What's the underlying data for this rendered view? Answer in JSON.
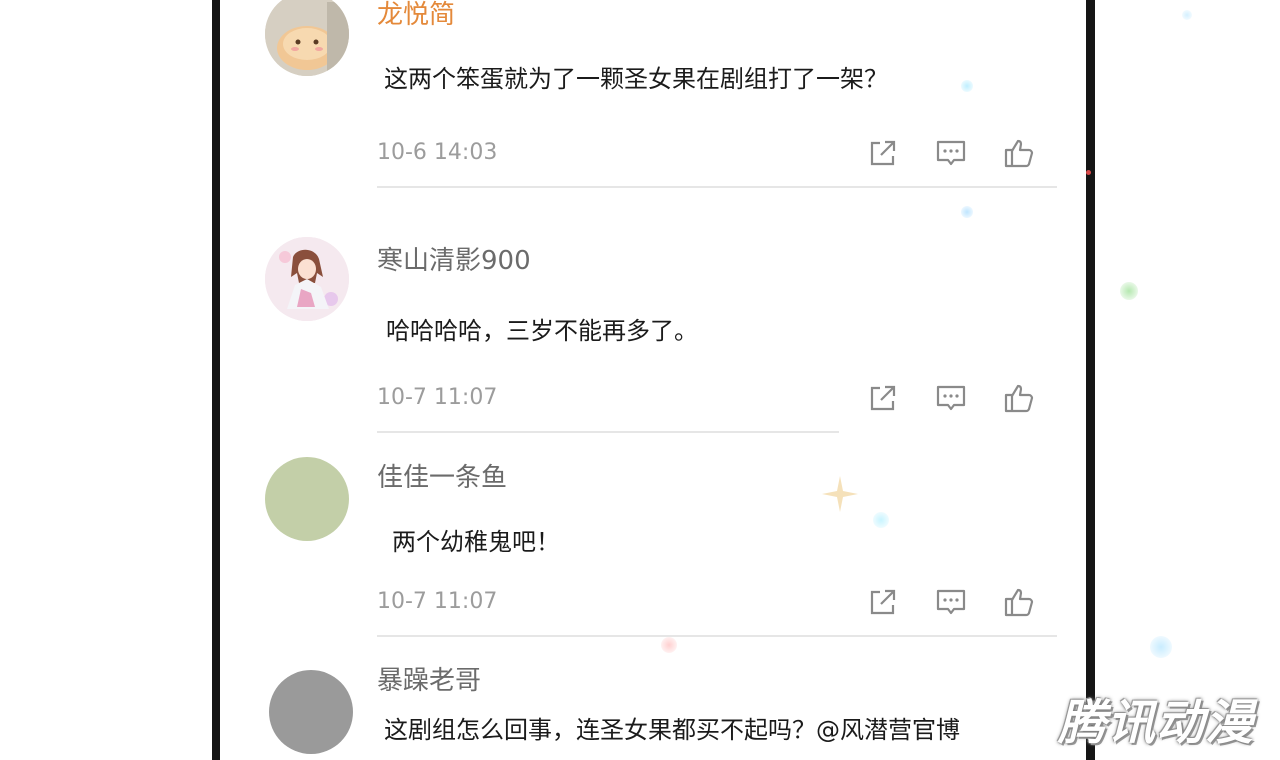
{
  "comments": [
    {
      "username": "龙悦简",
      "text": "这两个笨蛋就为了一颗圣女果在剧组打了一架？",
      "time": "10-6 14:03",
      "avatar": "bunny-plush-avatar",
      "username_color": "#e4893a"
    },
    {
      "username": "寒山清影900",
      "text": "哈哈哈哈，三岁不能再多了。",
      "time": "10-7 11:07",
      "avatar": "anime-girl-avatar"
    },
    {
      "username": "佳佳一条鱼",
      "text": "两个幼稚鬼吧！",
      "time": "10-7 11:07",
      "avatar": "green-circle-avatar"
    },
    {
      "username": "暴躁老哥",
      "text": "这剧组怎么回事，连圣女果都买不起吗？@风潜营官博",
      "avatar": "gray-circle-avatar"
    }
  ],
  "actions": [
    "share-icon",
    "comment-icon",
    "like-icon"
  ],
  "watermark": "腾讯动漫",
  "colors": {
    "bezel": "#151515",
    "text": "#1b1b1b",
    "username": "#6b6b6b",
    "timestamp": "#9c9c9c",
    "avatar_green": "#c3cfa8",
    "avatar_gray": "#9a9a9a"
  }
}
